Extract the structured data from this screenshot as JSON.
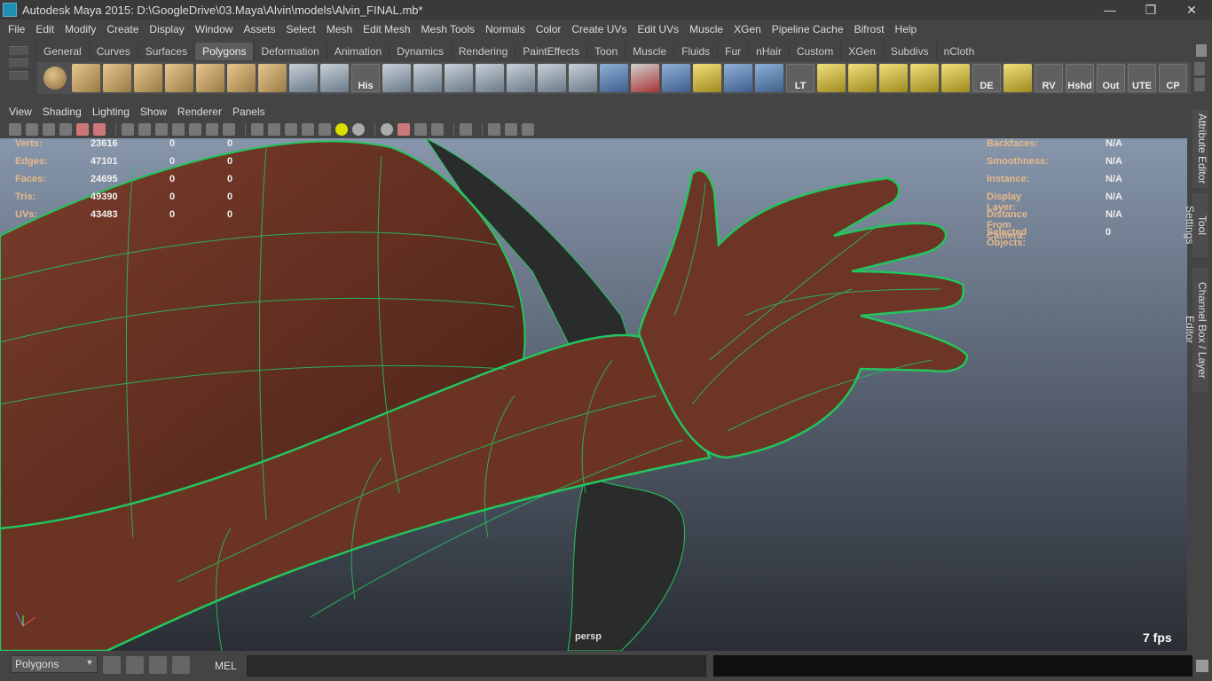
{
  "window": {
    "title": "Autodesk Maya 2015: D:\\GoogleDrive\\03.Maya\\Alvin\\models\\Alvin_FINAL.mb*",
    "minimize": "—",
    "restore": "❐",
    "close": "✕"
  },
  "menu": [
    "File",
    "Edit",
    "Modify",
    "Create",
    "Display",
    "Window",
    "Assets",
    "Select",
    "Mesh",
    "Edit Mesh",
    "Mesh Tools",
    "Normals",
    "Color",
    "Create UVs",
    "Edit UVs",
    "Muscle",
    "XGen",
    "Pipeline Cache",
    "Bifrost",
    "Help"
  ],
  "shelf": {
    "tabs": [
      "General",
      "Curves",
      "Surfaces",
      "Polygons",
      "Deformation",
      "Animation",
      "Dynamics",
      "Rendering",
      "PaintEffects",
      "Toon",
      "Muscle",
      "Fluids",
      "Fur",
      "nHair",
      "Custom",
      "XGen",
      "Subdivs",
      "nCloth"
    ],
    "active_tab": "Polygons",
    "icon_labels": {
      "his": "His",
      "lt": "LT",
      "de": "DE",
      "rv": "RV",
      "hshd": "Hshd",
      "out": "Out",
      "ute": "UTE",
      "cp": "CP"
    }
  },
  "panel_menu": [
    "View",
    "Shading",
    "Lighting",
    "Show",
    "Renderer",
    "Panels"
  ],
  "hud": {
    "left": [
      {
        "label": "Verts:",
        "value": "23616",
        "sel": "0",
        "sel2": "0"
      },
      {
        "label": "Edges:",
        "value": "47101",
        "sel": "0",
        "sel2": "0"
      },
      {
        "label": "Faces:",
        "value": "24695",
        "sel": "0",
        "sel2": "0"
      },
      {
        "label": "Tris:",
        "value": "49390",
        "sel": "0",
        "sel2": "0"
      },
      {
        "label": "UVs:",
        "value": "43483",
        "sel": "0",
        "sel2": "0"
      }
    ],
    "right": [
      {
        "label": "Backfaces:",
        "value": "N/A"
      },
      {
        "label": "Smoothness:",
        "value": "N/A"
      },
      {
        "label": "Instance:",
        "value": "N/A"
      },
      {
        "label": "Display Layer:",
        "value": "N/A"
      },
      {
        "label": "Distance From Camera:",
        "value": "N/A"
      },
      {
        "label": "Selected Objects:",
        "value": "0"
      }
    ],
    "camera": "persp",
    "fps": "7 fps"
  },
  "side_tabs": [
    "Attribute Editor",
    "Tool Settings",
    "Channel Box / Layer Editor"
  ],
  "bottom": {
    "mode": "Polygons",
    "command_type": "MEL",
    "command_value": ""
  },
  "colors": {
    "hud_label": "#e6b98a",
    "wireframe": "#22c55e",
    "skin": "#6b3424"
  }
}
